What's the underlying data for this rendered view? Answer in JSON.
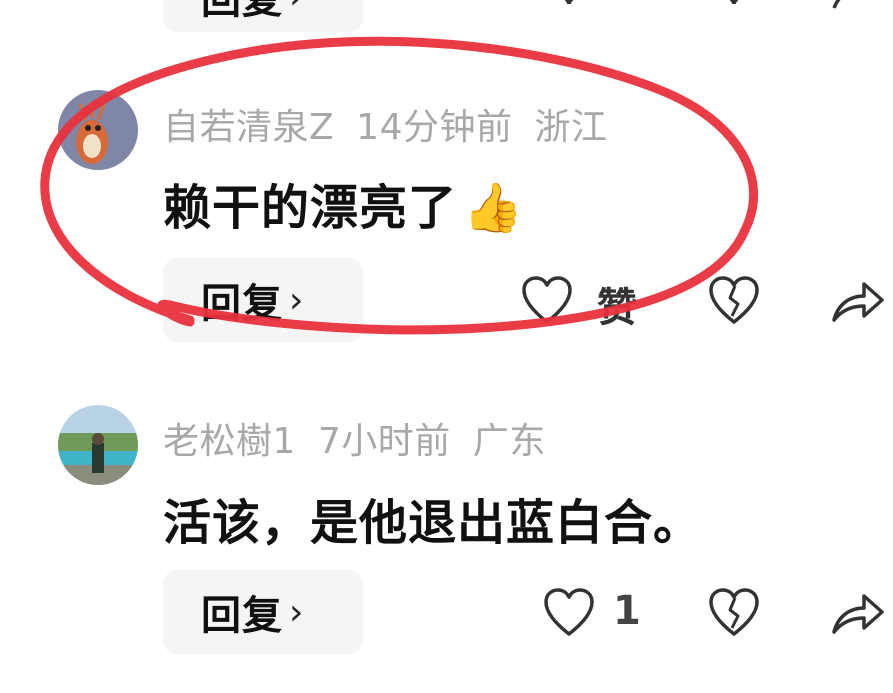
{
  "comments": [
    {
      "reply_label": "回复",
      "like_count": "",
      "partial": true
    },
    {
      "username": "自若清泉Z",
      "time": "14分钟前",
      "location": "浙江",
      "text": "赖干的漂亮了",
      "emoji": "👍",
      "reply_label": "回复",
      "like_label": "赞"
    },
    {
      "username": "老松樹1",
      "time": "7小时前",
      "location": "广东",
      "text": "活该，是他退出蓝白合。",
      "reply_label": "回复",
      "like_count": "1"
    }
  ],
  "icons": {
    "like": "heart-outline-icon",
    "dislike": "broken-heart-icon",
    "share": "share-arrow-icon",
    "chevron": "chevron-right-icon"
  },
  "annotation_color": "#e8323c"
}
